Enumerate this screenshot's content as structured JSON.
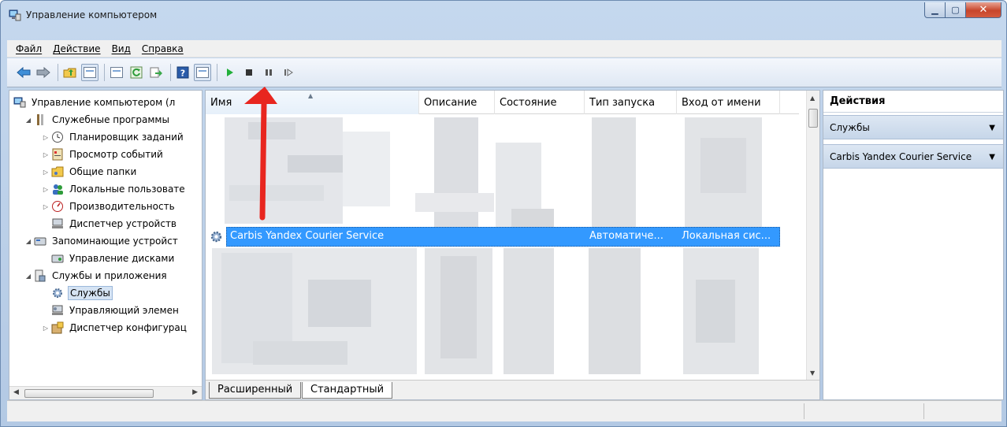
{
  "window": {
    "title": "Управление компьютером"
  },
  "menu": [
    "Файл",
    "Действие",
    "Вид",
    "Справка"
  ],
  "toolbar": {
    "buttons": [
      "back-icon",
      "forward-icon",
      "up-folder-icon",
      "show-tree-icon",
      "properties-icon",
      "refresh-icon",
      "export-icon",
      "help-icon",
      "show-action-pane-icon",
      "play-icon",
      "stop-icon",
      "pause-icon",
      "resume-icon"
    ]
  },
  "tree": {
    "items": [
      {
        "label": "Управление компьютером (л",
        "icon": "computer-management-icon"
      },
      {
        "label": "Служебные программы",
        "icon": "system-tools-icon"
      },
      {
        "label": "Планировщик заданий",
        "icon": "task-scheduler-icon"
      },
      {
        "label": "Просмотр событий",
        "icon": "event-viewer-icon"
      },
      {
        "label": "Общие папки",
        "icon": "shared-folders-icon"
      },
      {
        "label": "Локальные пользовате",
        "icon": "local-users-icon"
      },
      {
        "label": "Производительность",
        "icon": "performance-icon"
      },
      {
        "label": "Диспетчер устройств",
        "icon": "device-manager-icon"
      },
      {
        "label": "Запоминающие устройст",
        "icon": "storage-icon"
      },
      {
        "label": "Управление дисками",
        "icon": "disk-management-icon"
      },
      {
        "label": "Службы и приложения",
        "icon": "services-apps-icon"
      },
      {
        "label": "Службы",
        "icon": "services-icon"
      },
      {
        "label": "Управляющий элемен",
        "icon": "wmi-control-icon"
      },
      {
        "label": "Диспетчер конфигурац",
        "icon": "config-manager-icon"
      }
    ]
  },
  "list": {
    "columns": [
      "Имя",
      "Описание",
      "Состояние",
      "Тип запуска",
      "Вход от имени"
    ],
    "selected_service": {
      "name": "Carbis Yandex Courier Service",
      "description": "",
      "state": "",
      "startup": "Автоматиче...",
      "logon": "Локальная сис..."
    },
    "tabs": [
      "Расширенный",
      "Стандартный"
    ]
  },
  "actions": {
    "title": "Действия",
    "groups": [
      "Службы",
      "Carbis Yandex Courier Service"
    ]
  },
  "colors": {
    "selection": "#3399ff",
    "arrow": "#e8261f"
  }
}
